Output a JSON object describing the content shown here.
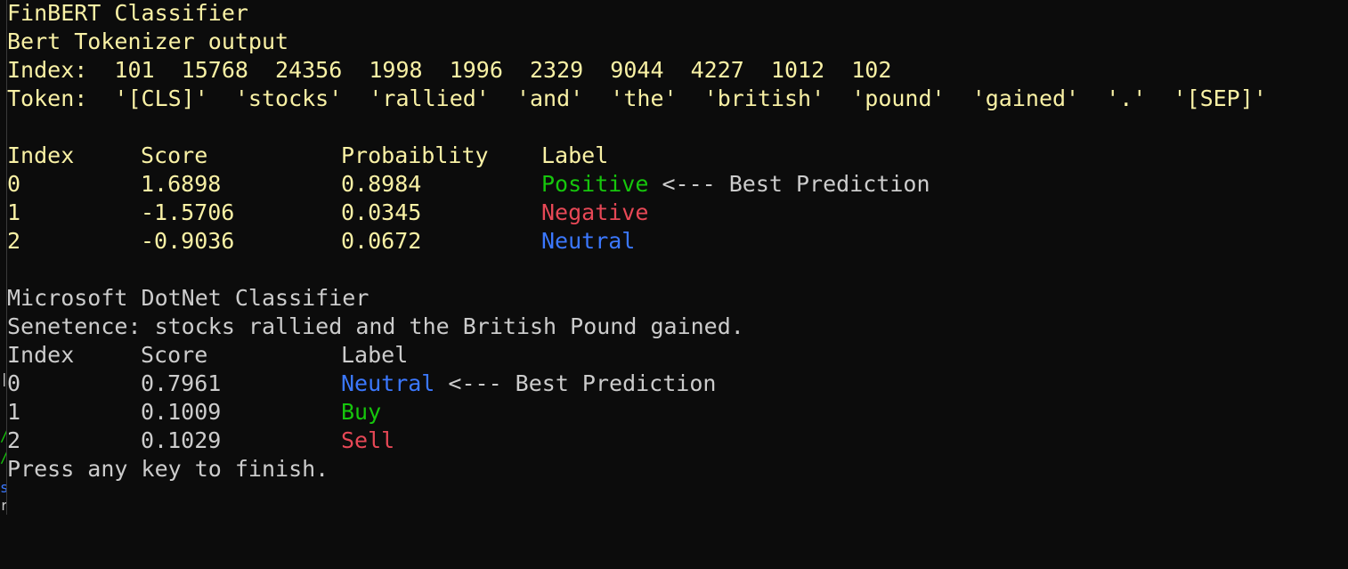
{
  "finbert": {
    "title": "FinBERT Classifier",
    "tokenizer_header": "Bert Tokenizer output",
    "index_line": "Index:  101  15768  24356  1998  1996  2329  9044  4227  1012  102",
    "token_line": "Token:  '[CLS]'  'stocks'  'rallied'  'and'  'the'  'british'  'pound'  'gained'  '.'  '[SEP]'",
    "headers": [
      "Index",
      "Score",
      "Probaiblity",
      "Label"
    ],
    "rows": [
      {
        "index": "0",
        "score": "1.6898",
        "prob": "0.8984",
        "label": "Positive",
        "suffix": " <--- Best Prediction"
      },
      {
        "index": "1",
        "score": "-1.5706",
        "prob": "0.0345",
        "label": "Negative",
        "suffix": ""
      },
      {
        "index": "2",
        "score": "-0.9036",
        "prob": "0.0672",
        "label": "Neutral",
        "suffix": ""
      }
    ]
  },
  "dotnet": {
    "title": "Microsoft DotNet Classifier",
    "sentence": "Senetence: stocks rallied and the British Pound gained.",
    "headers": [
      "Index",
      "Score",
      "Label"
    ],
    "rows": [
      {
        "index": "0",
        "score": "0.7961",
        "label": "Neutral",
        "suffix": " <--- Best Prediction"
      },
      {
        "index": "1",
        "score": "0.1009",
        "label": "Buy",
        "suffix": ""
      },
      {
        "index": "2",
        "score": "0.1029",
        "label": "Sell",
        "suffix": ""
      }
    ]
  },
  "footer": "Press any key to finish.",
  "colors": {
    "background": "#0c0c0c",
    "yellow_text": "#f9f1a5",
    "white_text": "#cccccc",
    "green": "#16c60c",
    "red": "#e74856",
    "blue": "#3b78ff"
  }
}
